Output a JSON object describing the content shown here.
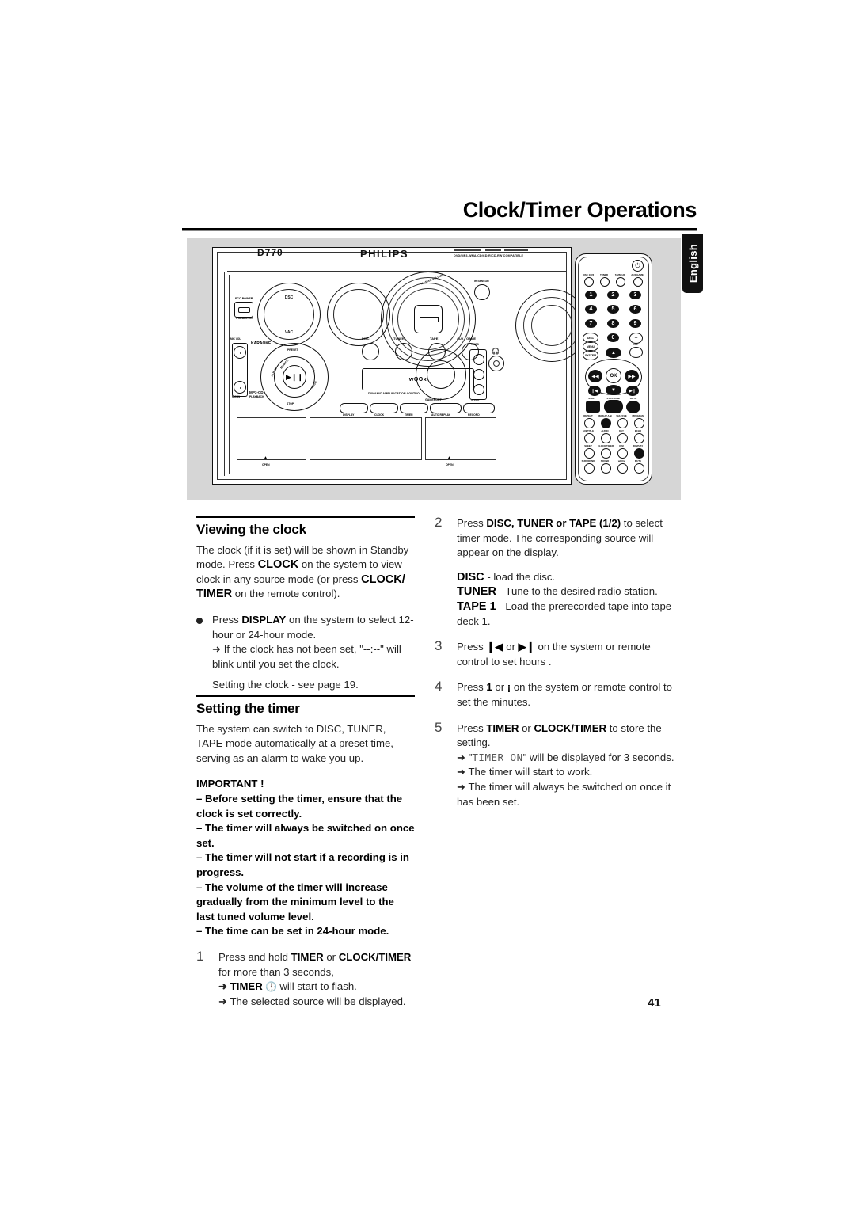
{
  "header": {
    "title": "Clock/Timer Operations",
    "language_tab": "English",
    "page_number": "41"
  },
  "figure": {
    "caption_alt": "philips-hifi-system-and-remote-control",
    "device": {
      "model": "D770",
      "brand": "PHILIPS",
      "compatibility": "DVD/MP3-WMA-CD/CD-R/CD-RW COMPATIBLE",
      "eco_power": "ECO POWER",
      "standby_on": "STANDBY ON",
      "dsc": "DSC",
      "vac": "VAC",
      "karaoke": "KARAOKE",
      "mic_vol": "MIC VOL",
      "mic_in": "MIC IN",
      "mp3_cd": "MP3-CD",
      "playback": "PLAYBACK",
      "master_volume": "MASTER VOLUME",
      "ir_sensor": "IR SENSOR",
      "woox": "wOOx",
      "dac": "DYNAMIC AMPLIFICATION CONTROL",
      "gameport": "GAMEPORT",
      "video": "VIDEO",
      "audio": "AUDIO",
      "open_left": "OPEN",
      "open_right": "OPEN",
      "source_buttons": [
        "DISC",
        "TUNER",
        "TAPE",
        "AUX • GAME"
      ],
      "function_buttons": [
        "DISPLAY",
        "CLOCK",
        "TIMER",
        "AUTO REPLAY",
        "RECORD"
      ],
      "nav_labels": [
        "PRESET",
        "ALBUM",
        "SEARCH",
        "VOL",
        "PROG",
        "STOP"
      ],
      "play_pause_glyph": "▶❙❙"
    },
    "remote": {
      "source_row": [
        "DISC 1/2/3",
        "TUNER",
        "TAPE 1/2",
        "AUX/GAME"
      ],
      "numbers": [
        "1",
        "2",
        "3",
        "4",
        "5",
        "6",
        "7",
        "8",
        "9",
        "0"
      ],
      "disc_menu": [
        "DISC",
        "MENU",
        "SYSTEM"
      ],
      "volume": [
        "+",
        "VOL",
        "−"
      ],
      "ok_label": "OK",
      "transport_labels": [
        "STOP",
        "PLAY/PAUSE",
        "GOTO"
      ],
      "row_a": [
        "REPEAT",
        "REPEAT A-B",
        "SHUFFLE",
        "PROGRAM"
      ],
      "row_b": [
        "SUBTITLE",
        "AUDIO",
        "KEY",
        "ECHO"
      ],
      "row_c": [
        "SLEEP",
        "CLOCK/TIMER",
        "DIM",
        "DISPLAY"
      ],
      "row_d": [
        "SURROUND",
        "SOUND",
        "wOOx",
        "MUTE"
      ]
    }
  },
  "left_column": {
    "section1": {
      "heading": "Viewing the clock",
      "paragraph1_a": "The clock (if it is set) will be shown in Standby mode.  Press ",
      "paragraph1_clock": "CLOCK",
      "paragraph1_b": "  on the system to view clock in any source mode  (or press ",
      "paragraph1_clocktimer": "CLOCK/ TIMER",
      "paragraph1_c": " on the remote control).",
      "bullet1_a": "Press ",
      "bullet1_display": "DISPLAY",
      "bullet1_b": " on the system to select 12-hour or 24-hour mode.",
      "bullet1_arrow": "➜ If the clock has not been set, \"--:--\" will blink until you set the clock.",
      "bullet1_note": "Setting the clock - see page 19."
    },
    "section2": {
      "heading": "Setting the timer",
      "paragraph1": "The system can switch to DISC, TUNER,  TAPE mode automatically at a preset time, serving as an alarm to wake you up.",
      "important_title": "IMPORTANT !",
      "important_items": [
        "–   Before setting the timer, ensure that the clock is set correctly.",
        "–   The timer will always be switched on once set.",
        "–   The timer will not start if a recording is in progress.",
        "–   The volume of the timer will increase gradually from the minimum level to the last tuned volume level.",
        "–   The time can be set in 24-hour mode."
      ],
      "step1": {
        "num": "1",
        "text_a": "Press and hold ",
        "bold1": "TIMER",
        "text_b": " or ",
        "bold2": "CLOCK/TIMER",
        "text_c": " for more than 3 seconds,",
        "arrow1_bold": "TIMER",
        "arrow1_rest": " will start to flash.",
        "arrow2": "➜ The selected source will be displayed."
      }
    }
  },
  "right_column": {
    "step2": {
      "num": "2",
      "text_a": "Press ",
      "bold": "DISC, TUNER or TAPE (1/2)",
      "text_b": " to select timer mode. The corresponding source will appear on the display.",
      "disc_bold": "DISC",
      "disc_rest": " - load the disc.",
      "tuner_bold": "TUNER",
      "tuner_rest": " - Tune to the desired radio station.",
      "tape_bold": "TAPE 1",
      "tape_rest": " - Load the prerecorded tape into tape deck 1."
    },
    "step3": {
      "num": "3",
      "text_a": "Press ",
      "glyph1": "❙◀",
      "text_b": " or ",
      "glyph2": "▶❙",
      "text_c": " on the system or remote control to set hours ."
    },
    "step4": {
      "num": "4",
      "text_a": "Press ",
      "glyph1": "1",
      "text_b": "    or ",
      "glyph2": "¡",
      "text_c": "    on the system or remote control to set the minutes."
    },
    "step5": {
      "num": "5",
      "text_a": "Press ",
      "bold1": "TIMER",
      "text_b": " or ",
      "bold2": "CLOCK/TIMER",
      "text_c": " to store the setting.",
      "arrow1_pre": "➜ \"",
      "arrow1_lcd": "TIMER ON",
      "arrow1_post": "\" will be displayed for 3 seconds.",
      "arrow2": "➜ The timer will start to work.",
      "arrow3": "➜ The timer will always be switched on once it has been set."
    }
  }
}
